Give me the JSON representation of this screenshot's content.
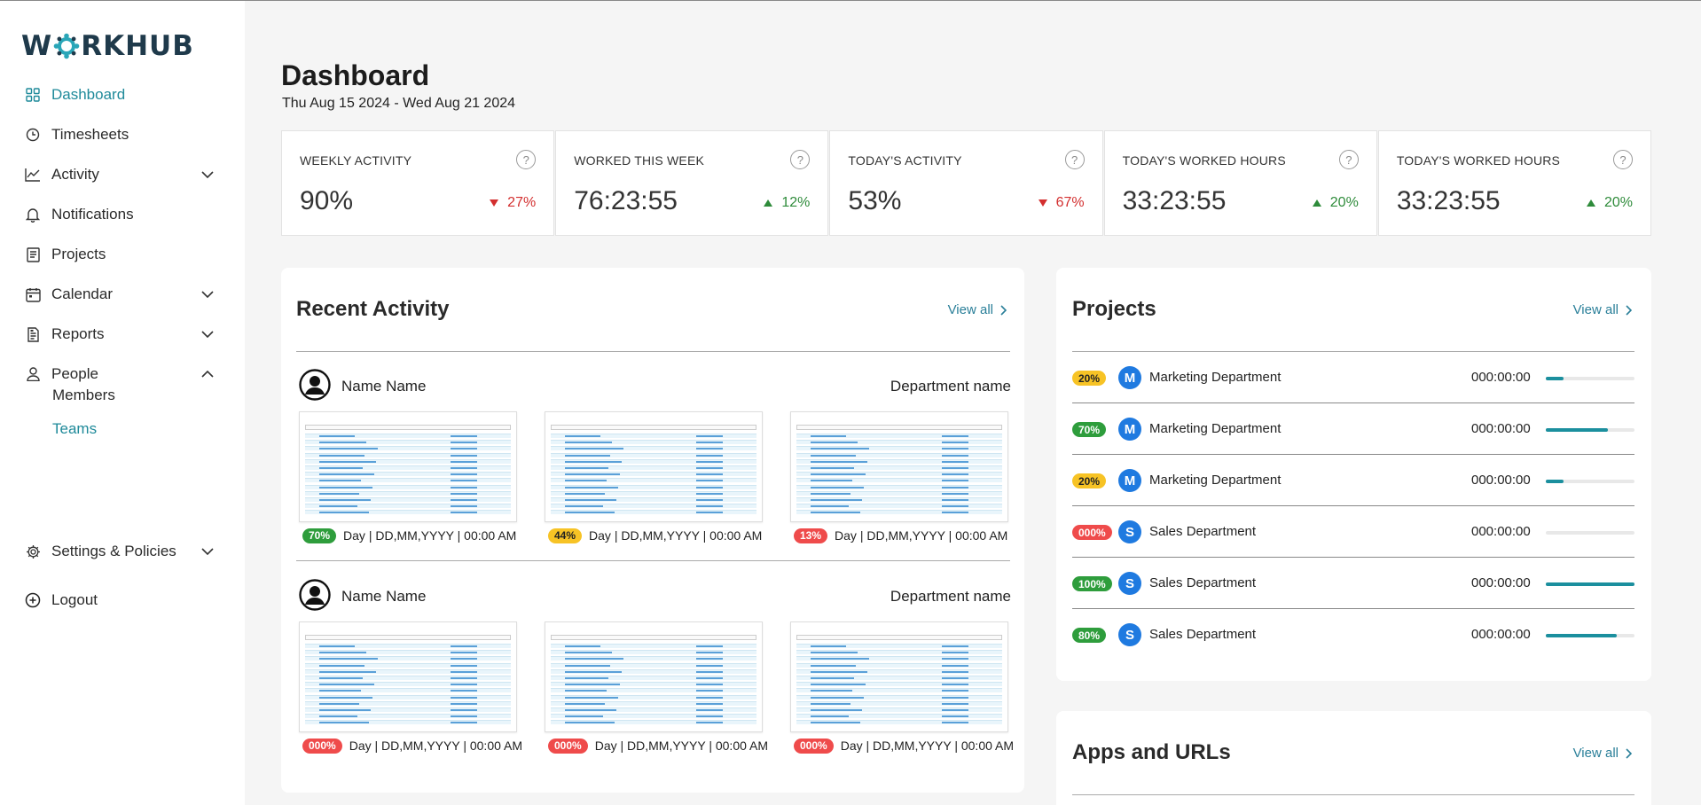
{
  "brand": {
    "name_left": "W",
    "name_right": "RKHUB"
  },
  "sidebar": {
    "items": [
      {
        "label": "Dashboard",
        "icon": "dashboard-icon",
        "active": true
      },
      {
        "label": "Timesheets",
        "icon": "clock-icon"
      },
      {
        "label": "Activity",
        "icon": "chart-line-icon",
        "chevron": "down"
      },
      {
        "label": "Notifications",
        "icon": "bell-icon"
      },
      {
        "label": "Projects",
        "icon": "clipboard-icon"
      },
      {
        "label": "Calendar",
        "icon": "calendar-icon",
        "chevron": "down"
      },
      {
        "label": "Reports",
        "icon": "report-icon",
        "chevron": "down"
      },
      {
        "label": "People",
        "icon": "person-icon",
        "chevron": "up"
      },
      {
        "label": "Settings & Policies",
        "icon": "gear-icon",
        "chevron": "down"
      },
      {
        "label": "Logout",
        "icon": "logout-icon"
      }
    ],
    "people_sub": [
      {
        "label": "Members"
      },
      {
        "label": "Teams",
        "active": true
      }
    ]
  },
  "header": {
    "title": "Dashboard",
    "date_range": "Thu Aug 15 2024 - Wed Aug 21 2024"
  },
  "stats": [
    {
      "label": "WEEKLY ACTIVITY",
      "value": "90%",
      "delta": "27%",
      "trend": "down"
    },
    {
      "label": "WORKED THIS WEEK",
      "value": "76:23:55",
      "delta": "12%",
      "trend": "up"
    },
    {
      "label": "TODAY'S ACTIVITY",
      "value": "53%",
      "delta": "67%",
      "trend": "down"
    },
    {
      "label": "TODAY'S WORKED HOURS",
      "value": "33:23:55",
      "delta": "20%",
      "trend": "up"
    },
    {
      "label": "TODAY'S WORKED HOURS",
      "value": "33:23:55",
      "delta": "20%",
      "trend": "up"
    }
  ],
  "recent_activity": {
    "title": "Recent Activity",
    "view_all": "View all",
    "groups": [
      {
        "name": "Name Name",
        "department": "Department name",
        "shots": [
          {
            "badge": "70%",
            "badge_color": "green",
            "meta": "Day | DD,MM,YYYY | 00:00 AM"
          },
          {
            "badge": "44%",
            "badge_color": "yellow",
            "meta": "Day | DD,MM,YYYY | 00:00 AM"
          },
          {
            "badge": "13%",
            "badge_color": "red",
            "meta": "Day | DD,MM,YYYY | 00:00 AM"
          }
        ]
      },
      {
        "name": "Name Name",
        "department": "Department name",
        "shots": [
          {
            "badge": "000%",
            "badge_color": "red",
            "meta": "Day | DD,MM,YYYY | 00:00 AM"
          },
          {
            "badge": "000%",
            "badge_color": "red",
            "meta": "Day | DD,MM,YYYY | 00:00 AM"
          },
          {
            "badge": "000%",
            "badge_color": "red",
            "meta": "Day | DD,MM,YYYY | 00:00 AM"
          }
        ]
      }
    ]
  },
  "projects": {
    "title": "Projects",
    "view_all": "View all",
    "rows": [
      {
        "badge": "20%",
        "badge_color": "yellow",
        "initial": "M",
        "name": "Marketing Department",
        "time": "000:00:00",
        "progress": 0.2
      },
      {
        "badge": "70%",
        "badge_color": "green",
        "initial": "M",
        "name": "Marketing Department",
        "time": "000:00:00",
        "progress": 0.7
      },
      {
        "badge": "20%",
        "badge_color": "yellow",
        "initial": "M",
        "name": "Marketing Department",
        "time": "000:00:00",
        "progress": 0.2
      },
      {
        "badge": "000%",
        "badge_color": "red",
        "initial": "S",
        "name": "Sales Department",
        "time": "000:00:00",
        "progress": 0.0
      },
      {
        "badge": "100%",
        "badge_color": "green",
        "initial": "S",
        "name": "Sales Department",
        "time": "000:00:00",
        "progress": 1.0
      },
      {
        "badge": "80%",
        "badge_color": "green",
        "initial": "S",
        "name": "Sales Department",
        "time": "000:00:00",
        "progress": 0.8
      }
    ]
  },
  "apps": {
    "title": "Apps and URLs",
    "view_all": "View all"
  },
  "colors": {
    "accent": "#1f8a9a",
    "link": "#2a7f99",
    "up": "#2e8b3a",
    "down": "#d32f2f",
    "badge_green": "#2e9d3c",
    "badge_yellow": "#f7c325",
    "badge_red": "#ef4b4b",
    "avatar_blue": "#1f7ae0"
  }
}
